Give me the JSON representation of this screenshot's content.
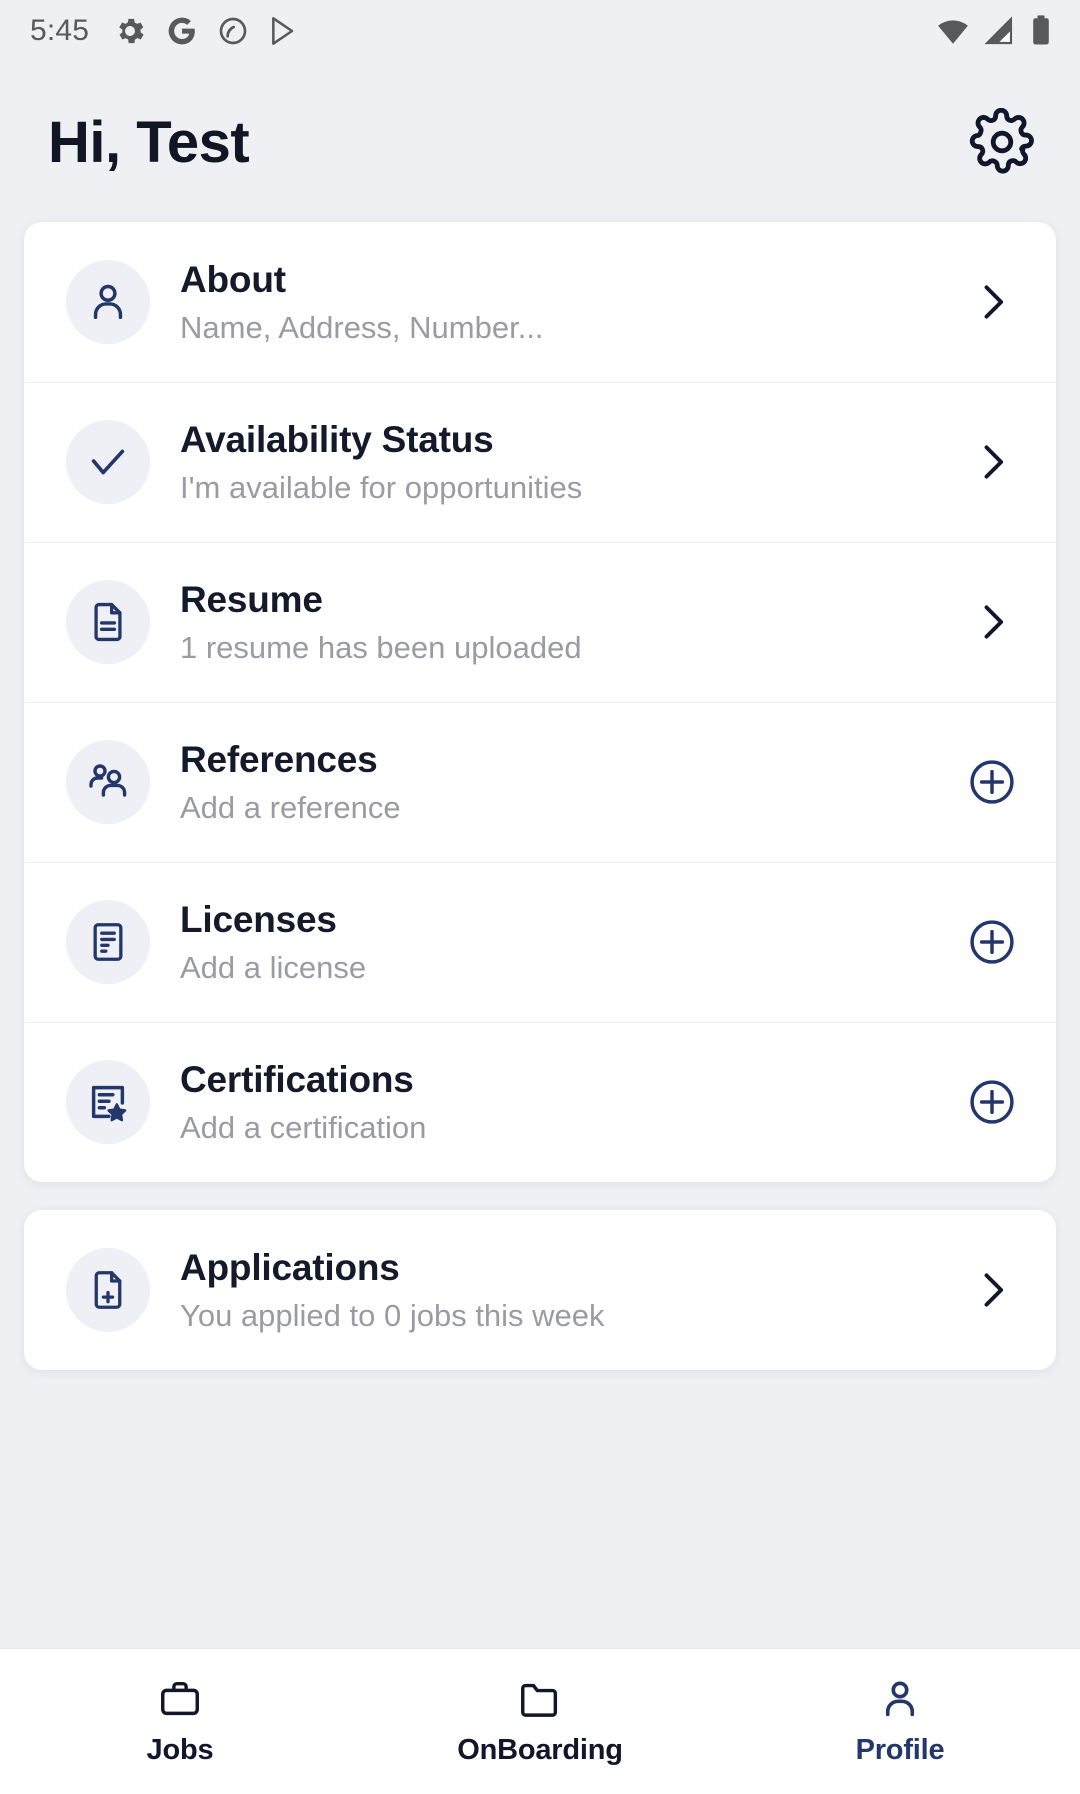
{
  "colors": {
    "page_background": "#eef0f4",
    "card_background": "#ffffff",
    "icon_navy": "#24376b",
    "title_dark": "#151a2b",
    "subtitle_gray": "#9b9ca3",
    "active_nav": "#24376b",
    "status_gray": "#58595c"
  },
  "status_bar": {
    "time": "5:45",
    "left_icons": [
      "gear-icon",
      "google-g-icon",
      "circle-slash-icon",
      "play-store-icon"
    ],
    "right_icons": [
      "wifi-icon",
      "cellular-signal-icon",
      "battery-icon"
    ]
  },
  "header": {
    "title": "Hi, Test",
    "settings_icon": "gear-icon"
  },
  "profile_card": {
    "rows": [
      {
        "icon": "person-icon",
        "title": "About",
        "subtitle": "Name, Address, Number...",
        "action": "chevron-right-icon"
      },
      {
        "icon": "check-icon",
        "title": "Availability Status",
        "subtitle": "I'm available for opportunities",
        "action": "chevron-right-icon"
      },
      {
        "icon": "document-icon",
        "title": "Resume",
        "subtitle": "1 resume has been uploaded",
        "action": "chevron-right-icon"
      },
      {
        "icon": "people-icon",
        "title": "References",
        "subtitle": "Add a reference",
        "action": "plus-circle-icon"
      },
      {
        "icon": "license-card-icon",
        "title": "Licenses",
        "subtitle": "Add a license",
        "action": "plus-circle-icon"
      },
      {
        "icon": "certificate-star-icon",
        "title": "Certifications",
        "subtitle": "Add a certification",
        "action": "plus-circle-icon"
      }
    ]
  },
  "applications_card": {
    "rows": [
      {
        "icon": "document-plus-icon",
        "title": "Applications",
        "subtitle": "You applied to 0 jobs this week",
        "action": "chevron-right-icon"
      }
    ]
  },
  "bottom_nav": {
    "items": [
      {
        "icon": "briefcase-icon",
        "label": "Jobs",
        "active": false
      },
      {
        "icon": "folder-icon",
        "label": "OnBoarding",
        "active": false
      },
      {
        "icon": "person-icon",
        "label": "Profile",
        "active": true
      }
    ]
  }
}
